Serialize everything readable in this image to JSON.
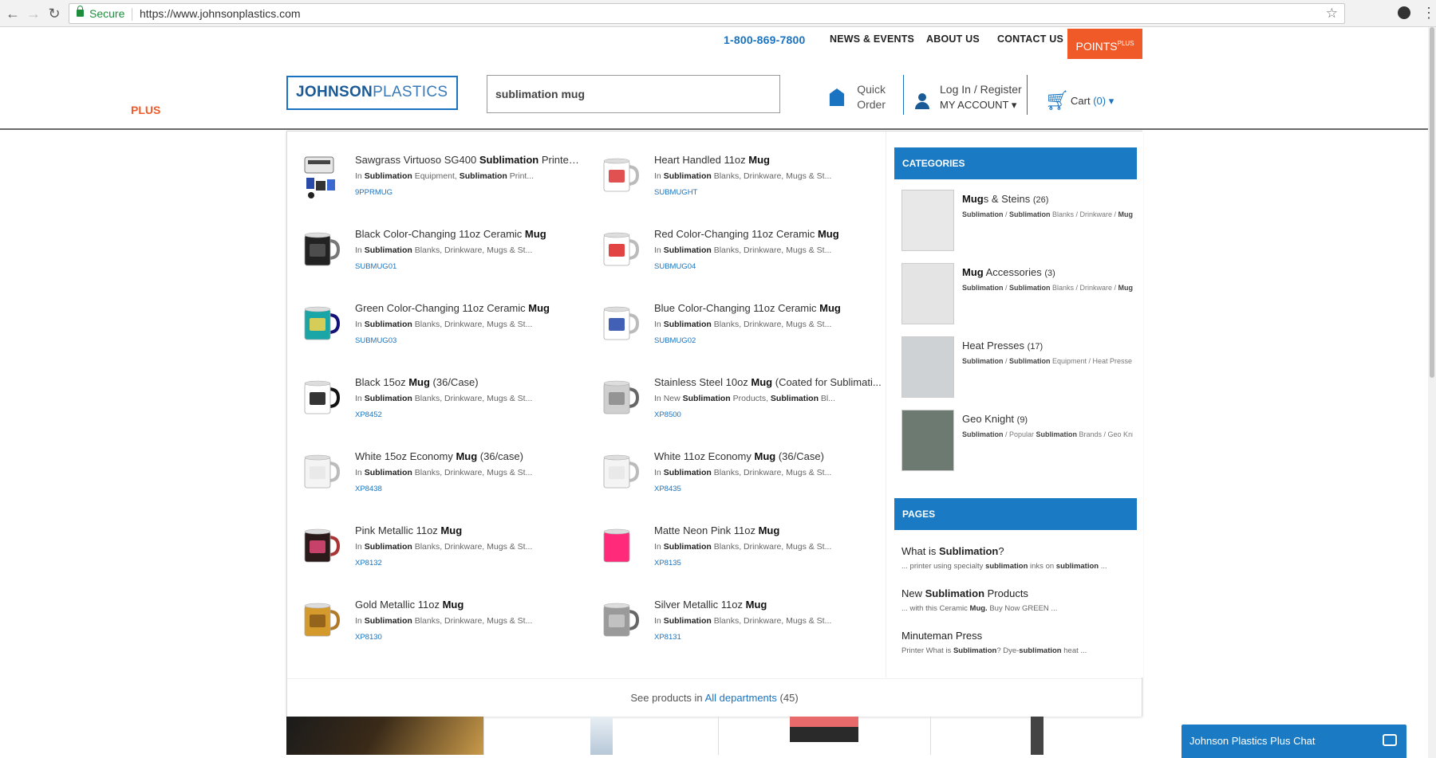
{
  "browser": {
    "secure_label": "Secure",
    "url": "https://www.johnsonplastics.com"
  },
  "topnav": {
    "phone": "1-800-869-7800",
    "news": "NEWS & EVENTS",
    "about": "ABOUT US",
    "contact": "CONTACT US",
    "points": "POINTS",
    "points_plus": "PLUS"
  },
  "header": {
    "logo_a": "JOHNSON",
    "logo_b": "PLASTICS",
    "logo_plus": "PLUS",
    "search_value": "sublimation mug",
    "quick1": "Quick",
    "quick2": "Order",
    "login": "Log In / Register",
    "account": "MY ACCOUNT ▾",
    "cart": "Cart",
    "cart_count": "(0) ▾"
  },
  "products": [
    {
      "pre": "Sawgrass Virtuoso SG400 ",
      "bold": "Sublimation",
      "post": " Printer ...",
      "cat": "Sublimation Equipment, Sublimation Print...",
      "sku": "9PPRMUG",
      "thumb": "printer"
    },
    {
      "pre": "Heart Handled 11oz ",
      "bold": "Mug",
      "post": "",
      "cat": "Sublimation Blanks, Drinkware, Mugs & St...",
      "sku": "SUBMUGHT",
      "thumb": "heart"
    },
    {
      "pre": "Black Color-Changing 11oz Ceramic ",
      "bold": "Mug",
      "post": "",
      "cat": "Sublimation Blanks, Drinkware, Mugs & St...",
      "sku": "SUBMUG01",
      "thumb": "black"
    },
    {
      "pre": "Red Color-Changing 11oz Ceramic ",
      "bold": "Mug",
      "post": "",
      "cat": "Sublimation Blanks, Drinkware, Mugs & St...",
      "sku": "SUBMUG04",
      "thumb": "red"
    },
    {
      "pre": "Green Color-Changing 11oz Ceramic ",
      "bold": "Mug",
      "post": "",
      "cat": "Sublimation Blanks, Drinkware, Mugs & St...",
      "sku": "SUBMUG03",
      "thumb": "green"
    },
    {
      "pre": "Blue Color-Changing 11oz Ceramic ",
      "bold": "Mug",
      "post": "",
      "cat": "Sublimation Blanks, Drinkware, Mugs & St...",
      "sku": "SUBMUG02",
      "thumb": "blue"
    },
    {
      "pre": "Black 15oz ",
      "bold": "Mug",
      "post": " (36/Case)",
      "cat": "Sublimation Blanks, Drinkware, Mugs & St...",
      "sku": "XP8452",
      "thumb": "blackplain"
    },
    {
      "pre": "Stainless Steel 10oz ",
      "bold": "Mug",
      "post": " (Coated for Sublimati...",
      "cat": "New Sublimation Products, Sublimation Bl...",
      "sku": "XP8500",
      "thumb": "steel"
    },
    {
      "pre": "White 15oz Economy ",
      "bold": "Mug",
      "post": " (36/case)",
      "cat": "Sublimation Blanks, Drinkware, Mugs & St...",
      "sku": "XP8438",
      "thumb": "white"
    },
    {
      "pre": "White 11oz Economy ",
      "bold": "Mug",
      "post": " (36/Case)",
      "cat": "Sublimation Blanks, Drinkware, Mugs & St...",
      "sku": "XP8435",
      "thumb": "white"
    },
    {
      "pre": "Pink Metallic 11oz ",
      "bold": "Mug",
      "post": "",
      "cat": "Sublimation Blanks, Drinkware, Mugs & St...",
      "sku": "XP8132",
      "thumb": "pinkmet"
    },
    {
      "pre": "Matte Neon Pink 11oz ",
      "bold": "Mug",
      "post": "",
      "cat": "Sublimation Blanks, Drinkware, Mugs & St...",
      "sku": "XP8135",
      "thumb": "neonpink"
    },
    {
      "pre": "Gold Metallic 11oz ",
      "bold": "Mug",
      "post": "",
      "cat": "Sublimation Blanks, Drinkware, Mugs & St...",
      "sku": "XP8130",
      "thumb": "gold"
    },
    {
      "pre": "Silver Metallic 11oz ",
      "bold": "Mug",
      "post": "",
      "cat": "Sublimation Blanks, Drinkware, Mugs & St...",
      "sku": "XP8131",
      "thumb": "silver"
    }
  ],
  "categories_title": "CATEGORIES",
  "categories": [
    {
      "bold": "Mug",
      "rest": "s & Steins",
      "count": "(26)",
      "path": "Sublimation / Sublimation Blanks / Drinkware / Mug"
    },
    {
      "bold": "Mug",
      "rest": " Accessories",
      "count": "(3)",
      "path": "Sublimation / Sublimation Blanks / Drinkware / Mug"
    },
    {
      "bold": "",
      "rest": "Heat Presses",
      "count": "(17)",
      "path": "Sublimation / Sublimation Equipment / Heat Presse"
    },
    {
      "bold": "",
      "rest": "Geo Knight",
      "count": "(9)",
      "path": "Sublimation / Popular Sublimation Brands / Geo Kni"
    }
  ],
  "pages_title": "PAGES",
  "pages": [
    {
      "title": "What is Sublimation?",
      "snippet": "... printer using specialty sublimation inks on sublimation ..."
    },
    {
      "title": "New Sublimation Products",
      "snippet": "... with this Ceramic Mug. Buy Now GREEN ..."
    },
    {
      "title": "Minuteman Press",
      "snippet": "Printer What is Sublimation? Dye-sublimation heat ..."
    }
  ],
  "footer": {
    "pre": "See products in",
    "link": "All departments",
    "count": "(45)"
  },
  "chat": "Johnson Plastics Plus Chat",
  "colors": {
    "brand_blue": "#1a7ac4",
    "accent_orange": "#f05a28"
  }
}
